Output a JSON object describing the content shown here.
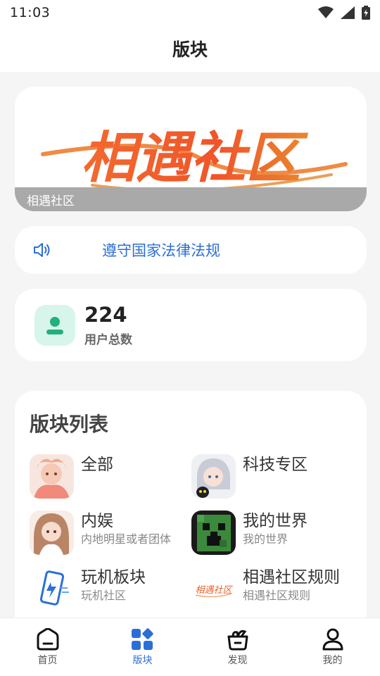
{
  "status_bar": {
    "time": "11:03",
    "icons": [
      "wifi-icon",
      "signal-icon",
      "battery-icon"
    ]
  },
  "header": {
    "title": "版块"
  },
  "banner": {
    "art_text": "相遇社区",
    "caption": "相遇社区"
  },
  "notice": {
    "icon": "speaker-icon",
    "text": "遵守国家法律法规"
  },
  "stats": {
    "count": "224",
    "label": "用户总数",
    "icon": "user-icon"
  },
  "boards": {
    "title": "版块列表",
    "items": [
      {
        "name": "全部",
        "desc": ""
      },
      {
        "name": "科技专区",
        "desc": ""
      },
      {
        "name": "内娱",
        "desc": "内地明星或者团体"
      },
      {
        "name": "我的世界",
        "desc": "我的世界"
      },
      {
        "name": "玩机板块",
        "desc": "玩机社区"
      },
      {
        "name": "相遇社区规则",
        "desc": "相遇社区规则",
        "thumb_text": "相遇社区"
      }
    ]
  },
  "tabbar": {
    "tabs": [
      {
        "label": "首页",
        "icon": "home-icon"
      },
      {
        "label": "版块",
        "icon": "grid-icon",
        "active": true
      },
      {
        "label": "发现",
        "icon": "discover-icon"
      },
      {
        "label": "我的",
        "icon": "profile-icon"
      }
    ]
  },
  "colors": {
    "accent": "#2b6fd6",
    "banner_orange": "#f05a28",
    "stats_bg": "#d8f5ec",
    "stats_icon": "#22b07d"
  }
}
